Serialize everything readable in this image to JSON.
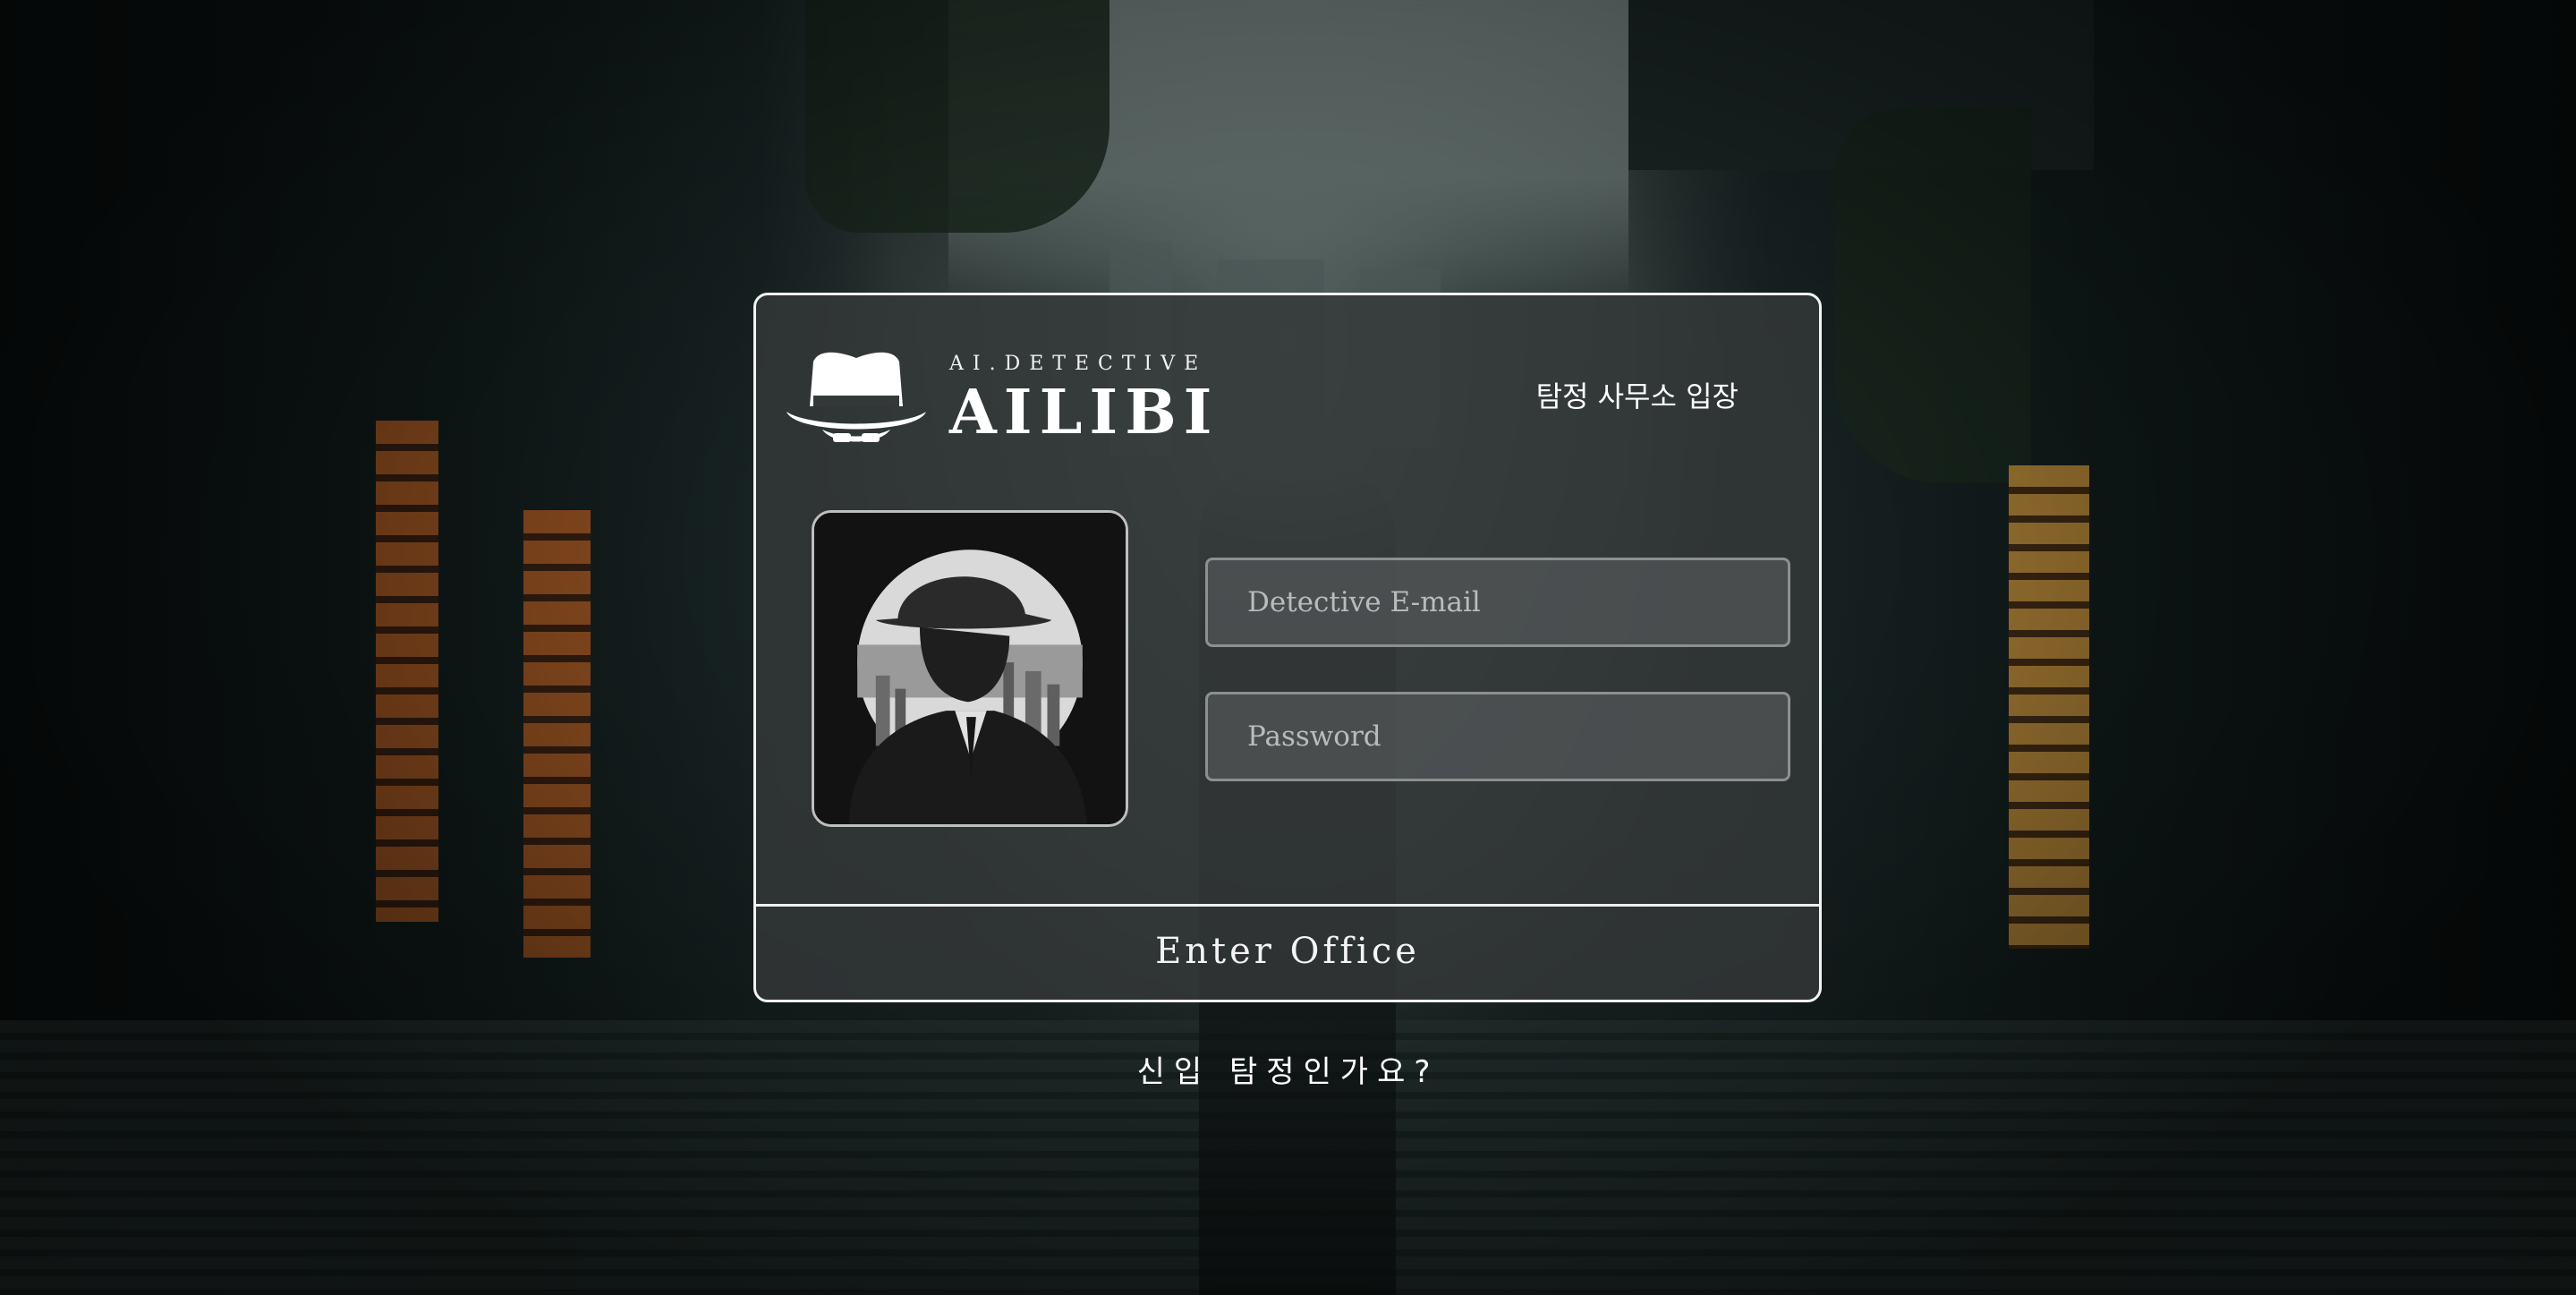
{
  "app": {
    "tagline": "AI.DETECTIVE",
    "name": "AILIBI"
  },
  "login_card": {
    "heading": "탐정 사무소 입장",
    "avatar_icon": "detective-portrait",
    "email": {
      "placeholder": "Detective E-mail",
      "value": ""
    },
    "password": {
      "placeholder": "Password",
      "value": ""
    },
    "submit_label": "Enter Office"
  },
  "signup_link": "신입 탐정인가요?",
  "icons": {
    "logo": "detective-hat-icon"
  },
  "colors": {
    "card_border": "#f2f2f2",
    "card_background": "#343839",
    "text": "#ffffff",
    "input_border": "#8d9090"
  }
}
